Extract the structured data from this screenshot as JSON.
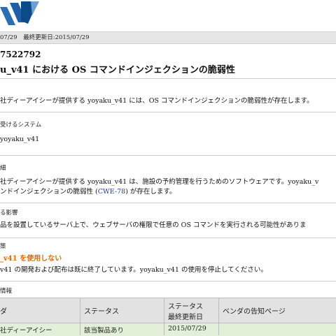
{
  "datebar": {
    "published": "07/29",
    "updated_label": "最終更新日:",
    "updated_date": "2015/07/29"
  },
  "vuln": {
    "id": "7522792",
    "title": "u_v41 における OS コマンドインジェクションの脆弱性"
  },
  "overview": {
    "text": "社ディーアイシーが提供する yoyaku_v41 には、OS コマンドインジェクションの脆弱性が存在します。"
  },
  "affected": {
    "heading": "受けるシステム",
    "item": "yoyaku_v41"
  },
  "detail": {
    "heading": "細",
    "line1": "社ディーアイシーが提供する yoyaku_v41 は、施設の予約管理を行うためのソフトウェアです。yoyaku_v",
    "line2_before": "ンドインジェクションの脆弱性 (",
    "line2_link": "CWE-78",
    "line2_after": ") が存在します。"
  },
  "impact": {
    "heading": "る影響",
    "text": "品を設置しているサーバ上で、ウェブサーバの権限で任意の OS コマンドを実行される可能性がありま"
  },
  "solution": {
    "heading": "策",
    "action": "_v41 を使用しない",
    "text": "v41 の開発および配布は既に終了しています。yoyaku_v41 の使用を停止してください。"
  },
  "vendor": {
    "heading": "情報",
    "col_vendor": "ダ",
    "col_status": "ステータス",
    "col_updated_line1": "ステータス",
    "col_updated_line2": "最終更新日",
    "col_notice": "ベンダの告知ページ",
    "rows": [
      {
        "vendor": "社ディーアイシー",
        "status": "該当製品あり",
        "updated": "2015/07/29",
        "notice": ""
      }
    ]
  },
  "colors": {
    "logo_blue": "#2a6fb6",
    "logo_dark": "#0d4a8a",
    "link": "#1a3fa0",
    "accent_orange": "#e06a00",
    "table_row": "#e2f0d9"
  }
}
